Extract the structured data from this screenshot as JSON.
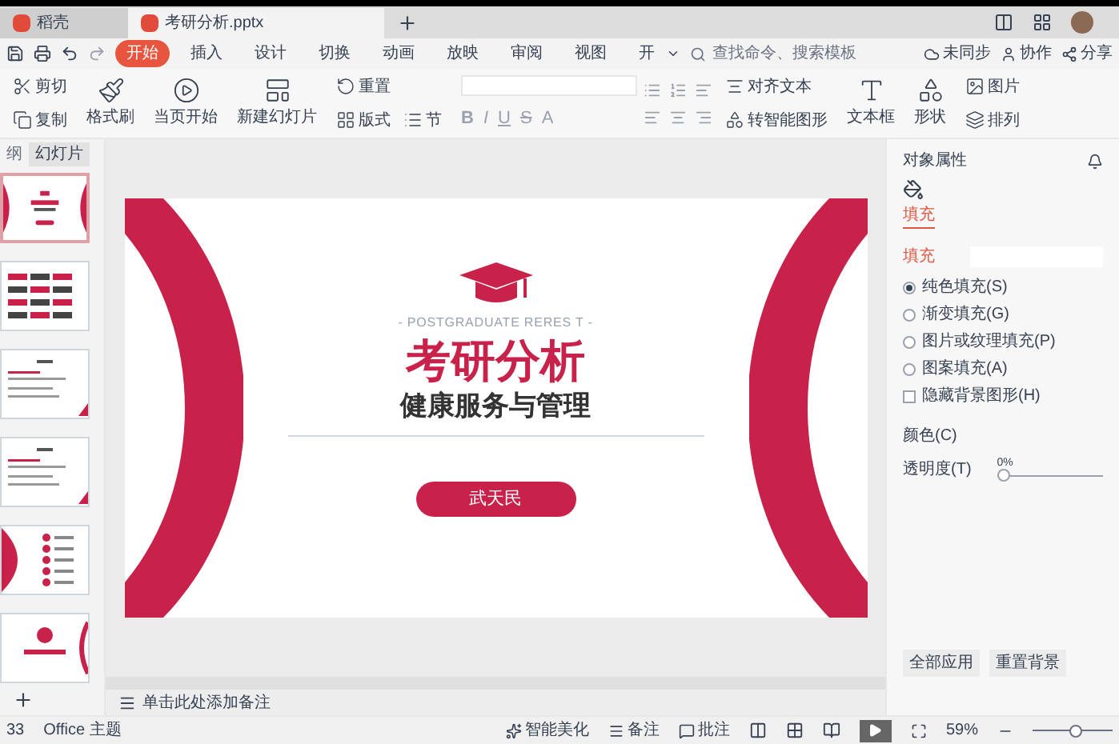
{
  "tabs": [
    {
      "label": "稻壳",
      "selected": false
    },
    {
      "label": "考研分析.pptx",
      "selected": true
    }
  ],
  "menu": [
    {
      "label": "开始",
      "selected": true
    },
    {
      "label": "插入",
      "selected": false
    },
    {
      "label": "设计",
      "selected": false
    },
    {
      "label": "切换",
      "selected": false
    },
    {
      "label": "动画",
      "selected": false
    },
    {
      "label": "放映",
      "selected": false
    },
    {
      "label": "审阅",
      "selected": false
    },
    {
      "label": "视图",
      "selected": false
    },
    {
      "label": "开",
      "selected": false
    }
  ],
  "search": {
    "placeholder": "查找命令、搜索模板"
  },
  "actions": [
    "未同步",
    "协作",
    "分享"
  ],
  "toolbar": {
    "clipboard": [
      "剪切",
      "复制"
    ],
    "brush": "格式刷",
    "play": "当页开始",
    "new_slide": "新建幻灯片",
    "layout": "版式",
    "section": "节",
    "reset": "重置",
    "format": [
      "B",
      "I",
      "U",
      "S",
      "A"
    ],
    "align_text": "对齐文本",
    "smart_art": "转智能图形",
    "textbox": "文本框",
    "shape": "形状",
    "picture": "图片",
    "arrange": "排列"
  },
  "left_panel": {
    "tabs": [
      {
        "label": "纲",
        "selected": false
      },
      {
        "label": "幻灯片",
        "selected": true
      }
    ],
    "slides": [
      {
        "kind": "title",
        "selected": true
      },
      {
        "kind": "tags",
        "selected": false
      },
      {
        "kind": "text",
        "selected": false
      },
      {
        "kind": "text",
        "selected": false
      },
      {
        "kind": "agenda",
        "selected": false
      },
      {
        "kind": "section",
        "selected": false
      }
    ]
  },
  "slide": {
    "overline": "- POSTGRADUATE RERES T -",
    "title": "考研分析",
    "subtitle": "健康服务与管理",
    "author": "武天民"
  },
  "notes": {
    "placeholder": "单击此处添加备注"
  },
  "properties": {
    "title": "对象属性",
    "tab": "填充",
    "section": "填充",
    "options": [
      {
        "kind": "radio",
        "label": "纯色填充(S)",
        "selected": true
      },
      {
        "kind": "radio",
        "label": "渐变填充(G)",
        "selected": false
      },
      {
        "kind": "radio",
        "label": "图片或纹理填充(P)",
        "selected": false
      },
      {
        "kind": "radio",
        "label": "图案填充(A)",
        "selected": false
      },
      {
        "kind": "checkbox",
        "label": "隐藏背景图形(H)",
        "checked": false
      }
    ],
    "color_label": "颜色(C)",
    "transparency_label": "透明度(T)",
    "transparency": {
      "level": 0,
      "reading": "0%"
    },
    "buttons": [
      "全部应用",
      "重置背景"
    ]
  },
  "status": {
    "slide_count": "33",
    "theme": "Office 主题",
    "beautify": "智能美化",
    "notes": "备注",
    "comments": "批注",
    "zoom": "59%",
    "zoom_slider": {
      "level": 0.55
    }
  }
}
